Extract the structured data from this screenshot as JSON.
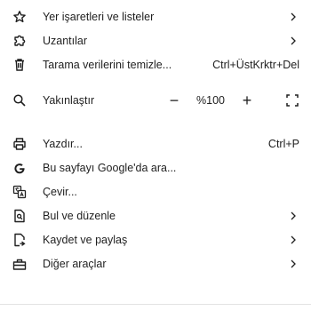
{
  "menu": {
    "items_top": [
      {
        "label": "Yer işaretleri ve listeler",
        "icon": "star-icon",
        "has_submenu": true
      },
      {
        "label": "Uzantılar",
        "icon": "puzzle-icon",
        "has_submenu": true
      },
      {
        "label": "Tarama verilerini temizle...",
        "icon": "trash-icon",
        "shortcut": "Ctrl+ÜstKrktr+Del"
      }
    ],
    "zoom": {
      "label": "Yakınlaştır",
      "icon": "zoom-icon",
      "minus": "−",
      "value": "%100",
      "plus": "+"
    },
    "items_bottom": [
      {
        "label": "Yazdır...",
        "icon": "printer-icon",
        "shortcut": "Ctrl+P"
      },
      {
        "label": "Bu sayfayı Google'da ara...",
        "icon": "google-icon"
      },
      {
        "label": "Çevir...",
        "icon": "translate-icon"
      },
      {
        "label": "Bul ve düzenle",
        "icon": "find-page-icon",
        "has_submenu": true
      },
      {
        "label": "Kaydet ve paylaş",
        "icon": "save-share-icon",
        "has_submenu": true
      },
      {
        "label": "Diğer araçlar",
        "icon": "toolbox-icon",
        "has_submenu": true
      }
    ]
  }
}
